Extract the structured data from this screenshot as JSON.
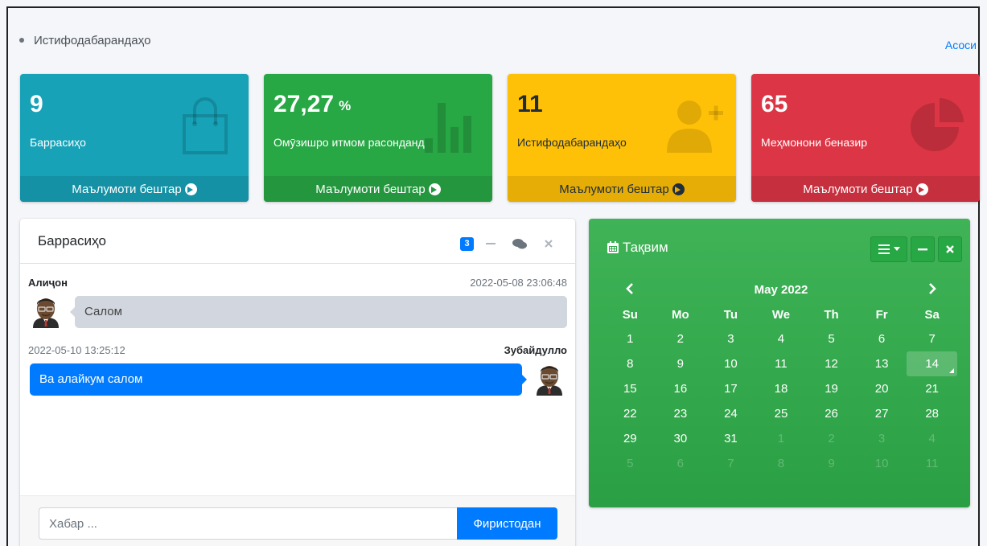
{
  "header": {
    "breadcrumb": "Истифодабарандаҳо",
    "home_link": "Асоси"
  },
  "stats": [
    {
      "value": "9",
      "unit": "",
      "label": "Баррасиҳо",
      "footer": "Маълумоти бештар",
      "icon": "shopping-bag-icon",
      "color": "#17a2b8"
    },
    {
      "value": "27,27",
      "unit": "%",
      "label": "Омӯзишро итмом расонданд",
      "footer": "Маълумоти бештар",
      "icon": "bar-chart-icon",
      "color": "#28a745"
    },
    {
      "value": "11",
      "unit": "",
      "label": "Истифодабарандаҳо",
      "footer": "Маълумоти бештар",
      "icon": "user-plus-icon",
      "color": "#ffc107"
    },
    {
      "value": "65",
      "unit": "",
      "label": "Меҳмонони беназир",
      "footer": "Маълумоти бештар",
      "icon": "pie-chart-icon",
      "color": "#dc3545"
    }
  ],
  "chat": {
    "title": "Баррасиҳо",
    "badge": "3",
    "messages": [
      {
        "name": "Алиҷон",
        "time": "2022-05-08 23:06:48",
        "text": "Салом",
        "side": "left"
      },
      {
        "name": "Зубайдулло",
        "time": "2022-05-10 13:25:12",
        "text": "Ва алайкум салом",
        "side": "right"
      }
    ],
    "input_placeholder": "Хабар ...",
    "send_label": "Фиристодан"
  },
  "calendar": {
    "title": "Тақвим",
    "month": "May 2022",
    "weekdays": [
      "Su",
      "Mo",
      "Tu",
      "We",
      "Th",
      "Fr",
      "Sa"
    ],
    "today": "14",
    "weeks": [
      [
        "1",
        "2",
        "3",
        "4",
        "5",
        "6",
        "7"
      ],
      [
        "8",
        "9",
        "10",
        "11",
        "12",
        "13",
        "14"
      ],
      [
        "15",
        "16",
        "17",
        "18",
        "19",
        "20",
        "21"
      ],
      [
        "22",
        "23",
        "24",
        "25",
        "26",
        "27",
        "28"
      ],
      [
        "29",
        "30",
        "31",
        "1",
        "2",
        "3",
        "4"
      ],
      [
        "5",
        "6",
        "7",
        "8",
        "9",
        "10",
        "11"
      ]
    ],
    "muted_from": {
      "week": 4,
      "day": 3
    }
  }
}
